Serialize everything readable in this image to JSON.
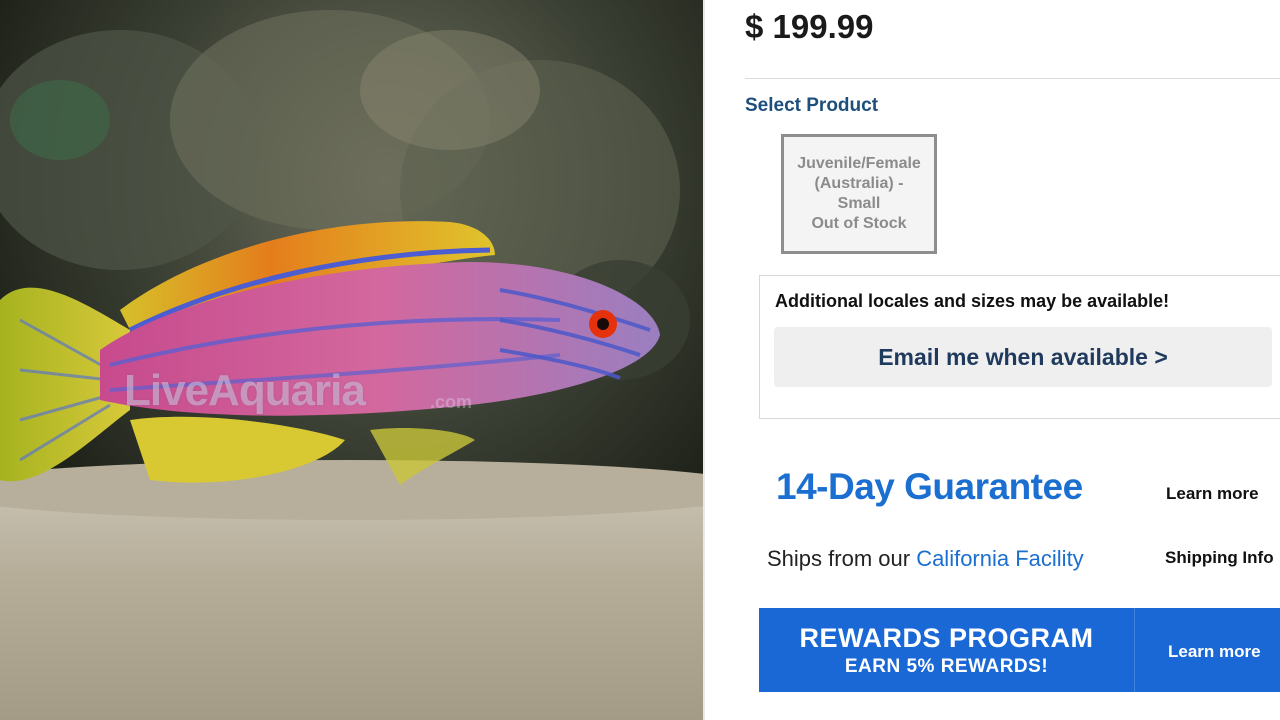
{
  "product": {
    "price": "$ 199.99",
    "photo_watermark": "LiveAquaria",
    "photo_watermark_suffix": ".com"
  },
  "select_product": {
    "label": "Select Product",
    "variants": [
      {
        "line1": "Juvenile/Female",
        "line2": "(Australia) -",
        "line3": "Small",
        "status": "Out of Stock"
      }
    ]
  },
  "availability": {
    "notice": "Additional locales and sizes may be available!",
    "email_button": "Email me when available >"
  },
  "guarantee": {
    "title": "14-Day Guarantee",
    "learn_more": "Learn more"
  },
  "shipping": {
    "prefix": "Ships from our",
    "facility": "California Facility",
    "info_link": "Shipping Info"
  },
  "rewards": {
    "title": "REWARDS PROGRAM",
    "subtitle": "EARN 5% REWARDS!",
    "learn_more": "Learn more"
  },
  "colors": {
    "accent_blue": "#1b6fd1",
    "rewards_blue": "#1a68d6",
    "heading_navy": "#1d4f7c"
  }
}
